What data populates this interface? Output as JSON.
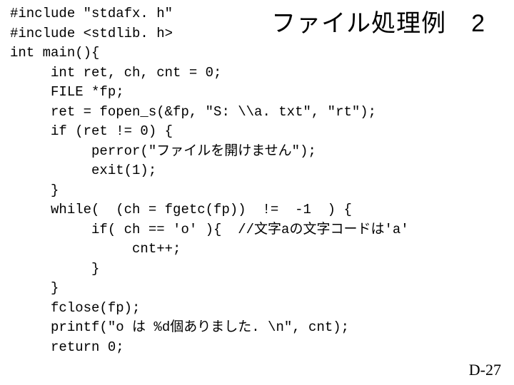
{
  "title": "ファイル処理例　2",
  "pagenum": "D-27",
  "code": {
    "l01": "#include \"stdafx. h\"",
    "l02": "#include <stdlib. h>",
    "l03": "int main(){",
    "l04": "     int ret, ch, cnt = 0;",
    "l05": "     FILE *fp;",
    "l06": "     ret = fopen_s(&fp, \"S: \\\\a. txt\", \"rt\");",
    "l07": "     if (ret != 0) {",
    "l08": "          perror(\"ファイルを開けません\");",
    "l09": "          exit(1);",
    "l10": "     }",
    "l11": "     while(  (ch = fgetc(fp))  !=  -1  ) {",
    "l12": "          if( ch == 'o' ){  //文字aの文字コードは'a'",
    "l13": "               cnt++;",
    "l14": "          }",
    "l15": "     }",
    "l16": "     fclose(fp);",
    "l17": "     printf(\"o は %d個ありました. \\n\", cnt);",
    "l18": "     return 0;"
  }
}
